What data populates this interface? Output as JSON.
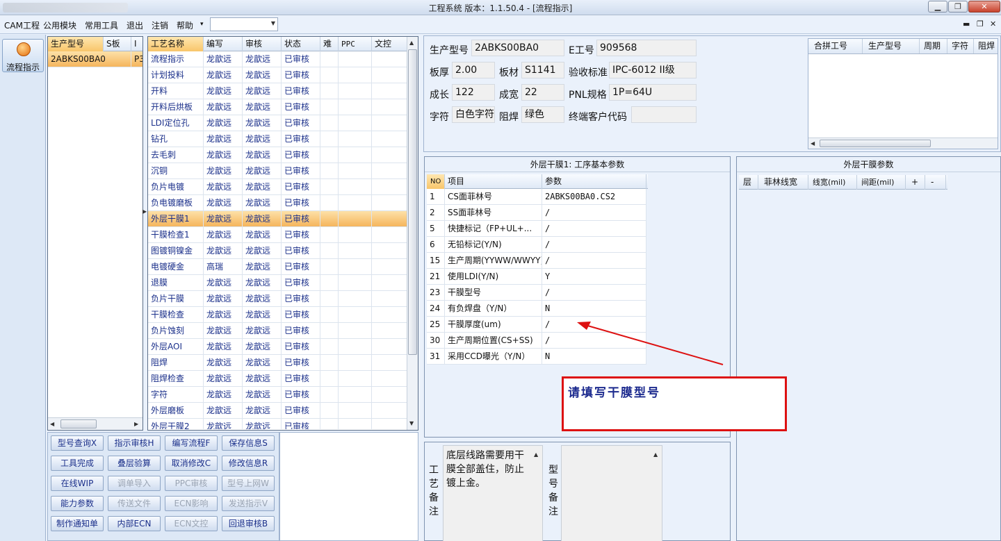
{
  "window": {
    "title": "工程系统   版本：1.1.50.4 - [流程指示]",
    "controls": [
      "minimize",
      "maximize",
      "close"
    ]
  },
  "menu": {
    "items": [
      "CAM工程",
      "公用模块",
      "常用工具",
      "退出",
      "注销",
      "帮助"
    ],
    "help_arrow": "▾",
    "combo_value": ""
  },
  "nav": {
    "button_label": "流程指示",
    "icon": "flow-icon"
  },
  "model_list": {
    "columns": [
      "生产型号",
      "S板",
      "I"
    ],
    "rows": [
      [
        "2ABKS00BA0",
        "",
        "P3"
      ]
    ]
  },
  "process_grid": {
    "columns": [
      "工艺名称",
      "编写",
      "审核",
      "状态",
      "难",
      "PPC",
      "文控"
    ],
    "rows": [
      [
        "流程指示",
        "龙歆远",
        "龙歆远",
        "已审核"
      ],
      [
        "计划投料",
        "龙歆远",
        "龙歆远",
        "已审核"
      ],
      [
        "开料",
        "龙歆远",
        "龙歆远",
        "已审核"
      ],
      [
        "开料后烘板",
        "龙歆远",
        "龙歆远",
        "已审核"
      ],
      [
        "LDI定位孔",
        "龙歆远",
        "龙歆远",
        "已审核"
      ],
      [
        "钻孔",
        "龙歆远",
        "龙歆远",
        "已审核"
      ],
      [
        "去毛刺",
        "龙歆远",
        "龙歆远",
        "已审核"
      ],
      [
        "沉铜",
        "龙歆远",
        "龙歆远",
        "已审核"
      ],
      [
        "负片电镀",
        "龙歆远",
        "龙歆远",
        "已审核"
      ],
      [
        "负电镀磨板",
        "龙歆远",
        "龙歆远",
        "已审核"
      ],
      [
        "外层干膜1",
        "龙歆远",
        "龙歆远",
        "已审核"
      ],
      [
        "干膜检查1",
        "龙歆远",
        "龙歆远",
        "已审核"
      ],
      [
        "图镀铜镍金",
        "龙歆远",
        "龙歆远",
        "已审核"
      ],
      [
        "电镀硬金",
        "高瑞",
        "龙歆远",
        "已审核"
      ],
      [
        "退膜",
        "龙歆远",
        "龙歆远",
        "已审核"
      ],
      [
        "负片干膜",
        "龙歆远",
        "龙歆远",
        "已审核"
      ],
      [
        "干膜检查",
        "龙歆远",
        "龙歆远",
        "已审核"
      ],
      [
        "负片蚀刻",
        "龙歆远",
        "龙歆远",
        "已审核"
      ],
      [
        "外层AOI",
        "龙歆远",
        "龙歆远",
        "已审核"
      ],
      [
        "阻焊",
        "龙歆远",
        "龙歆远",
        "已审核"
      ],
      [
        "阻焊检查",
        "龙歆远",
        "龙歆远",
        "已审核"
      ],
      [
        "字符",
        "龙歆远",
        "龙歆远",
        "已审核"
      ],
      [
        "外层磨板",
        "龙歆远",
        "龙歆远",
        "已审核"
      ],
      [
        "外层干膜2",
        "龙歆远",
        "龙歆远",
        "已审核"
      ]
    ],
    "selected_row": 10
  },
  "actions": {
    "rows": [
      [
        {
          "label": "型号查询X",
          "enabled": true
        },
        {
          "label": "指示审核H",
          "enabled": true
        },
        {
          "label": "编写流程F",
          "enabled": true
        },
        {
          "label": "保存信息S",
          "enabled": true
        }
      ],
      [
        {
          "label": "工具完成",
          "enabled": true
        },
        {
          "label": "叠层验算",
          "enabled": true
        },
        {
          "label": "取消修改C",
          "enabled": true
        },
        {
          "label": "修改信息R",
          "enabled": true
        }
      ],
      [
        {
          "label": "在线WIP",
          "enabled": true
        },
        {
          "label": "调单导入",
          "enabled": false
        },
        {
          "label": "PPC审核",
          "enabled": false
        },
        {
          "label": "型号上网W",
          "enabled": false
        }
      ],
      [
        {
          "label": "能力参数",
          "enabled": true
        },
        {
          "label": "传送文件",
          "enabled": false
        },
        {
          "label": "ECN影响",
          "enabled": false
        },
        {
          "label": "发送指示V",
          "enabled": false
        }
      ],
      [
        {
          "label": "制作通知单",
          "enabled": true
        },
        {
          "label": "内部ECN",
          "enabled": true
        },
        {
          "label": "ECN文控",
          "enabled": false
        },
        {
          "label": "回退审核B",
          "enabled": true
        }
      ]
    ]
  },
  "info": {
    "fields": [
      {
        "label": "生产型号",
        "value": "2ABKS00BA0"
      },
      {
        "label": "E工号",
        "value": "909568"
      },
      {
        "label": "板厚",
        "value": "2.00"
      },
      {
        "label": "板材",
        "value": "S1141"
      },
      {
        "label": "验收标准",
        "value": "IPC-6012 II级"
      },
      {
        "label": "成长",
        "value": "122"
      },
      {
        "label": "成宽",
        "value": "22"
      },
      {
        "label": "PNL规格",
        "value": "1P=64U"
      },
      {
        "label": "字符",
        "value": "白色字符"
      },
      {
        "label": "阻焊",
        "value": "绿色"
      },
      {
        "label": "终端客户代码",
        "value": ""
      }
    ],
    "merge_grid": {
      "columns": [
        "合拼工号",
        "生产型号",
        "周期",
        "字符",
        "阻焊"
      ]
    }
  },
  "params": {
    "title": "外层干膜1: 工序基本参数",
    "columns": [
      "NO",
      "项目",
      "参数"
    ],
    "rows": [
      [
        "1",
        "CS面菲林号",
        "2ABKS00BA0.CS2"
      ],
      [
        "2",
        "SS面菲林号",
        "/"
      ],
      [
        "5",
        "快捷标记（FP+UL+...",
        "/"
      ],
      [
        "6",
        "无铅标记(Y/N)",
        "/"
      ],
      [
        "15",
        "生产周期(YYWW/WWYY)",
        "/"
      ],
      [
        "21",
        "使用LDI(Y/N)",
        "Y"
      ],
      [
        "23",
        "干膜型号",
        "/"
      ],
      [
        "24",
        "有负焊盘（Y/N）",
        "N"
      ],
      [
        "25",
        "干膜厚度(um)",
        "/"
      ],
      [
        "30",
        "生产周期位置(CS+SS)",
        "/"
      ],
      [
        "31",
        "采用CCD曝光（Y/N）",
        "N"
      ]
    ]
  },
  "film_params": {
    "title": "外层干膜参数",
    "columns": [
      "层",
      "菲林线宽",
      "线宽(mil)",
      "间距(mil)",
      "+",
      "-"
    ]
  },
  "remarks": {
    "process_label": "工艺备注",
    "process_text": "底层线路需要用干膜全部盖住，防止镀上金。",
    "model_label": "型号备注",
    "model_text": ""
  },
  "annotation": {
    "callout_text": "请填写干膜型号",
    "color": "#dd1111"
  }
}
